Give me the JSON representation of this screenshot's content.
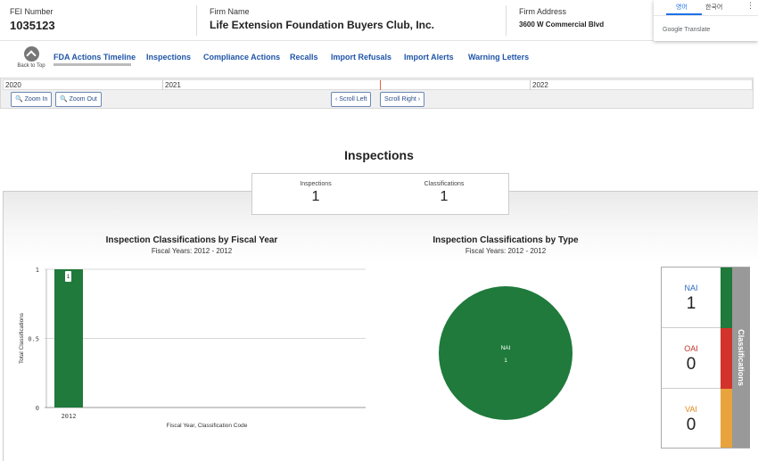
{
  "header": {
    "fei_label": "FEI Number",
    "fei_value": "1035123",
    "firm_name_label": "Firm Name",
    "firm_name_value": "Life Extension Foundation Buyers Club, Inc.",
    "firm_address_label": "Firm Address",
    "firm_address_value": "3600 W Commercial Blvd"
  },
  "translate_popup": {
    "tab_1": "영어",
    "tab_2": "한국어",
    "more": "⋮",
    "brand": "Google Translate"
  },
  "nav": {
    "back_to_top": "Back to Top",
    "tabs": [
      "FDA Actions Timeline",
      "Inspections",
      "Compliance Actions",
      "Recalls",
      "Import Refusals",
      "Import Alerts",
      "Warning Letters"
    ]
  },
  "timeline": {
    "years": [
      "2020",
      "2021",
      "2022"
    ],
    "zoom_in": "🔍 Zoom In",
    "zoom_out": "🔍 Zoom Out",
    "scroll_left": "‹ Scroll Left",
    "scroll_right": "Scroll Right ›"
  },
  "section_title": "Inspections",
  "stats": {
    "inspections_label": "Inspections",
    "inspections_value": "1",
    "classifications_label": "Classifications",
    "classifications_value": "1"
  },
  "colors": {
    "nai": "#1f7a3b",
    "oai": "#d2332b",
    "vai": "#e8a33d",
    "link": "#1f56a8"
  },
  "bar_chart": {
    "title": "Inspection Classifications by Fiscal Year",
    "subtitle": "Fiscal Years: 2012 - 2012"
  },
  "pie_chart": {
    "title": "Inspection Classifications by Type",
    "subtitle": "Fiscal Years: 2012 - 2012"
  },
  "chart_data": [
    {
      "type": "bar",
      "title": "Inspection Classifications by Fiscal Year",
      "subtitle": "Fiscal Years: 2012 - 2012",
      "xlabel": "Fiscal Year, Classification Code",
      "ylabel": "Total Classifications",
      "categories": [
        "2012"
      ],
      "series": [
        {
          "name": "NAI",
          "values": [
            1
          ]
        }
      ],
      "data_labels": [
        "1"
      ],
      "yticks": [
        "0",
        "0.5",
        "1"
      ],
      "ylim": [
        0,
        1
      ],
      "grid": true
    },
    {
      "type": "pie",
      "title": "Inspection Classifications by Type",
      "subtitle": "Fiscal Years: 2012 - 2012",
      "slices": [
        {
          "label": "NAI",
          "value": 1
        }
      ]
    }
  ],
  "classifications": {
    "side_label": "Classifications",
    "items": [
      {
        "name": "NAI",
        "value": "1"
      },
      {
        "name": "OAI",
        "value": "0"
      },
      {
        "name": "VAI",
        "value": "0"
      }
    ]
  }
}
